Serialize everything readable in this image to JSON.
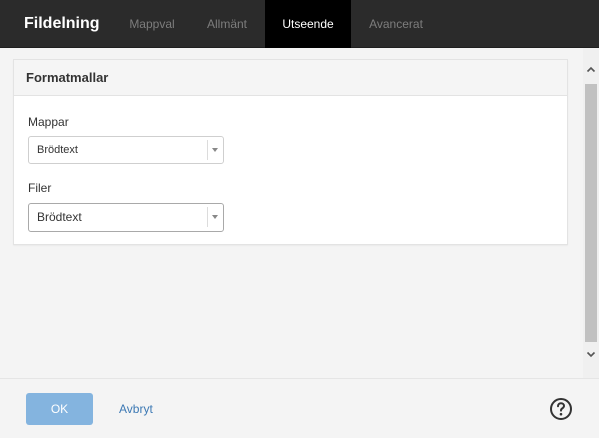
{
  "header": {
    "title": "Fildelning",
    "tabs": [
      {
        "label": "Mappval",
        "active": false
      },
      {
        "label": "Allmänt",
        "active": false
      },
      {
        "label": "Utseende",
        "active": true
      },
      {
        "label": "Avancerat",
        "active": false
      }
    ]
  },
  "panel": {
    "title": "Formatmallar",
    "fields": [
      {
        "label": "Mappar",
        "value": "Brödtext"
      },
      {
        "label": "Filer",
        "value": "Brödtext"
      }
    ]
  },
  "footer": {
    "ok_label": "OK",
    "cancel_label": "Avbryt",
    "help_icon": "help-circle-icon"
  },
  "colors": {
    "topbar": "#2b2b2b",
    "active_tab": "#000000",
    "ok_button": "#84b4df",
    "link": "#3d79b4"
  }
}
